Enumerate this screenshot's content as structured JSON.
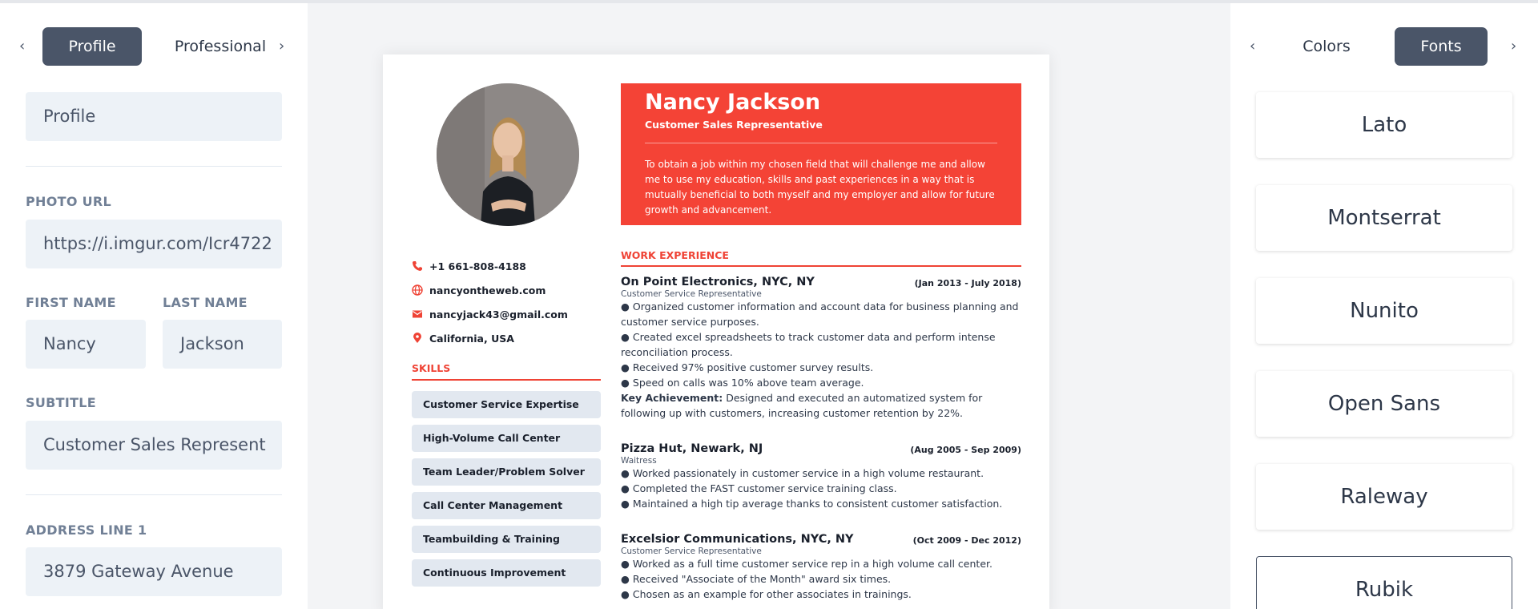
{
  "left_panel": {
    "tabs": [
      "Profile",
      "Professional"
    ],
    "section_title": "Profile",
    "photo_url": {
      "label": "PHOTO URL",
      "value": "https://i.imgur.com/Icr4722"
    },
    "first_name": {
      "label": "FIRST NAME",
      "value": "Nancy"
    },
    "last_name": {
      "label": "LAST NAME",
      "value": "Jackson"
    },
    "subtitle": {
      "label": "SUBTITLE",
      "value": "Customer Sales Represent"
    },
    "address_line_1": {
      "label": "ADDRESS LINE 1",
      "value": "3879 Gateway Avenue"
    }
  },
  "right_panel": {
    "tabs": [
      "Colors",
      "Fonts"
    ],
    "fonts": [
      "Lato",
      "Montserrat",
      "Nunito",
      "Open Sans",
      "Raleway",
      "Rubik"
    ],
    "selected_font": "Rubik"
  },
  "resume": {
    "accent_color": "#f44336",
    "name": "Nancy Jackson",
    "subtitle": "Customer Sales Representative",
    "objective": "To obtain a job within my chosen field that will challenge me and allow me to use my education, skills and past experiences in a way that is mutually beneficial to both myself and my employer and allow for future growth and advancement.",
    "contacts": [
      {
        "icon": "phone-icon",
        "text": "+1 661-808-4188"
      },
      {
        "icon": "globe-icon",
        "text": "nancyontheweb.com"
      },
      {
        "icon": "mail-icon",
        "text": "nancyjack43@gmail.com"
      },
      {
        "icon": "location-icon",
        "text": "California, USA"
      }
    ],
    "skills_title": "SKILLS",
    "skills": [
      "Customer Service Expertise",
      "High-Volume Call Center",
      "Team Leader/Problem Solver",
      "Call Center Management",
      "Teambuilding & Training",
      "Continuous Improvement"
    ],
    "work_title": "WORK EXPERIENCE",
    "jobs": [
      {
        "company": "On Point Electronics, NYC, NY",
        "dates": "(Jan 2013 - July 2018)",
        "role": "Customer Service Representative",
        "bullets": [
          "● Organized customer information and account data for business planning and customer service purposes.",
          "● Created excel spreadsheets to track customer data and perform intense reconciliation process.",
          "● Received 97% positive customer survey results.",
          "● Speed on calls was 10% above team average."
        ],
        "achievement_label": "Key Achievement:",
        "achievement": "Designed and executed an automatized system for following up with customers, increasing customer retention by 22%."
      },
      {
        "company": "Pizza Hut, Newark, NJ",
        "dates": "(Aug 2005 - Sep 2009)",
        "role": "Waitress",
        "bullets": [
          "● Worked passionately in customer service in a high volume restaurant.",
          "● Completed the FAST customer service training class.",
          "● Maintained a high tip average thanks to consistent customer satisfaction."
        ]
      },
      {
        "company": "Excelsior Communications, NYC, NY",
        "dates": "(Oct 2009 - Dec 2012)",
        "role": "Customer Service Representative",
        "bullets": [
          "● Worked as a full time customer service rep in a high volume call center.",
          "● Received \"Associate of the Month\" award six times.",
          "● Chosen as an example for other associates in trainings."
        ]
      }
    ]
  }
}
